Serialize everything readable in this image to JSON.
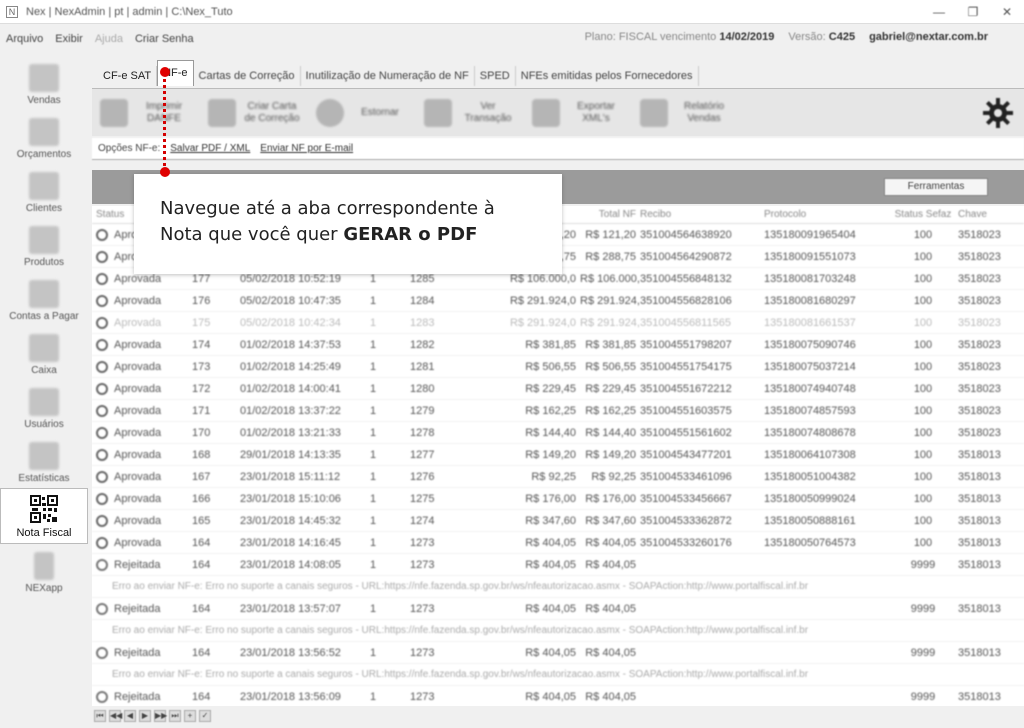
{
  "window": {
    "title": "Nex | NexAdmin | pt | admin | C:\\Nex_Tuto",
    "buttons": [
      "—",
      "❐",
      "✕"
    ]
  },
  "menu": {
    "items": [
      "Arquivo",
      "Exibir",
      "Ajuda",
      "Criar Senha"
    ],
    "plano_label": "Plano:",
    "plano_value": "FISCAL",
    "vencimento_label": "vencimento",
    "vencimento_value": "14/02/2019",
    "versao_label": "Versão:",
    "versao_value": "C425",
    "user_email": "gabriel@nextar.com.br"
  },
  "sidebar": {
    "items": [
      {
        "label": "Vendas",
        "icon": "cart-icon"
      },
      {
        "label": "Orçamentos",
        "icon": "document-icon"
      },
      {
        "label": "Clientes",
        "icon": "clients-icon"
      },
      {
        "label": "Produtos",
        "icon": "products-icon"
      },
      {
        "label": "Contas a Pagar",
        "icon": "bills-icon"
      },
      {
        "label": "Caixa",
        "icon": "cash-register-icon"
      },
      {
        "label": "Usuários",
        "icon": "users-icon"
      },
      {
        "label": "Estatísticas",
        "icon": "chart-icon"
      },
      {
        "label": "Nota Fiscal",
        "icon": "qr-code-icon"
      },
      {
        "label": "NEXapp",
        "icon": "phone-icon"
      }
    ],
    "active": "Nota Fiscal"
  },
  "tabs": [
    {
      "label": "CF-e SAT"
    },
    {
      "label": "NF-e"
    },
    {
      "label": "Cartas de Correção"
    },
    {
      "label": "Inutilização de Numeração de NF"
    },
    {
      "label": "SPED"
    },
    {
      "label": "NFEs emitidas pelos Fornecedores"
    }
  ],
  "toolbar": {
    "buttons": [
      {
        "label": "Imprimir DANFE",
        "icon": "printer-icon"
      },
      {
        "label": "Criar Carta de Correção",
        "icon": "correction-letter-icon"
      },
      {
        "label": "Estornar",
        "icon": "reverse-icon"
      },
      {
        "label": "Ver Transação",
        "icon": "view-transaction-icon"
      },
      {
        "label": "Exportar XML's",
        "icon": "export-icon"
      },
      {
        "label": "Relatório Vendas",
        "icon": "report-icon"
      }
    ]
  },
  "options_bar": {
    "label": "Opções NF-e:",
    "links": [
      "Salvar PDF / XML",
      "Enviar NF por E-mail"
    ]
  },
  "panel": {
    "tools_button": "Ferramentas"
  },
  "table": {
    "columns": [
      "Status",
      "",
      "",
      "",
      "",
      "Total NF",
      "Recibo",
      "Protocolo",
      "Status Sefaz",
      "Chave"
    ],
    "rows": [
      {
        "type": "ok",
        "status": "Aprovada",
        "n": "",
        "date": "",
        "s": "",
        "num": "",
        "total": "R$ 121,20",
        "total2": "R$ 121,20",
        "recibo": "351004564638920",
        "prot": "135180091965404",
        "sefaz": "100",
        "chave": "3518023"
      },
      {
        "type": "ok",
        "status": "Aprovada",
        "n": "",
        "date": "",
        "s": "",
        "num": "",
        "total": "R$ 288,75",
        "total2": "R$ 288,75",
        "recibo": "351004564290872",
        "prot": "135180091551073",
        "sefaz": "100",
        "chave": "3518023"
      },
      {
        "type": "ok",
        "status": "Aprovada",
        "n": "177",
        "date": "05/02/2018 10:52:19",
        "s": "1",
        "num": "1285",
        "total": "R$ 106.000,0",
        "total2": "R$ 106.000,0",
        "recibo": "351004556848132",
        "prot": "135180081703248",
        "sefaz": "100",
        "chave": "3518023"
      },
      {
        "type": "ok",
        "status": "Aprovada",
        "n": "176",
        "date": "05/02/2018 10:47:35",
        "s": "1",
        "num": "1284",
        "total": "R$ 291.924,0",
        "total2": "R$ 291.924,0",
        "recibo": "351004556828106",
        "prot": "135180081680297",
        "sefaz": "100",
        "chave": "3518023"
      },
      {
        "type": "faded",
        "status": "Aprovada",
        "n": "175",
        "date": "05/02/2018 10:42:34",
        "s": "1",
        "num": "1283",
        "total": "R$ 291.924,0",
        "total2": "R$ 291.924,0",
        "recibo": "351004556811565",
        "prot": "135180081661537",
        "sefaz": "100",
        "chave": "3518023"
      },
      {
        "type": "ok",
        "status": "Aprovada",
        "n": "174",
        "date": "01/02/2018 14:37:53",
        "s": "1",
        "num": "1282",
        "total": "R$ 381,85",
        "total2": "R$ 381,85",
        "recibo": "351004551798207",
        "prot": "135180075090746",
        "sefaz": "100",
        "chave": "3518023"
      },
      {
        "type": "ok",
        "status": "Aprovada",
        "n": "173",
        "date": "01/02/2018 14:25:49",
        "s": "1",
        "num": "1281",
        "total": "R$ 506,55",
        "total2": "R$ 506,55",
        "recibo": "351004551754175",
        "prot": "135180075037214",
        "sefaz": "100",
        "chave": "3518023"
      },
      {
        "type": "ok",
        "status": "Aprovada",
        "n": "172",
        "date": "01/02/2018 14:00:41",
        "s": "1",
        "num": "1280",
        "total": "R$ 229,45",
        "total2": "R$ 229,45",
        "recibo": "351004551672212",
        "prot": "135180074940748",
        "sefaz": "100",
        "chave": "3518023"
      },
      {
        "type": "ok",
        "status": "Aprovada",
        "n": "171",
        "date": "01/02/2018 13:37:22",
        "s": "1",
        "num": "1279",
        "total": "R$ 162,25",
        "total2": "R$ 162,25",
        "recibo": "351004551603575",
        "prot": "135180074857593",
        "sefaz": "100",
        "chave": "3518023"
      },
      {
        "type": "ok",
        "status": "Aprovada",
        "n": "170",
        "date": "01/02/2018 13:21:33",
        "s": "1",
        "num": "1278",
        "total": "R$ 144,40",
        "total2": "R$ 144,40",
        "recibo": "351004551561602",
        "prot": "135180074808678",
        "sefaz": "100",
        "chave": "3518023"
      },
      {
        "type": "ok",
        "status": "Aprovada",
        "n": "168",
        "date": "29/01/2018 14:13:35",
        "s": "1",
        "num": "1277",
        "total": "R$ 149,20",
        "total2": "R$ 149,20",
        "recibo": "351004543477201",
        "prot": "135180064107308",
        "sefaz": "100",
        "chave": "3518013"
      },
      {
        "type": "ok",
        "status": "Aprovada",
        "n": "167",
        "date": "23/01/2018 15:11:12",
        "s": "1",
        "num": "1276",
        "total": "R$ 92,25",
        "total2": "R$ 92,25",
        "recibo": "351004533461096",
        "prot": "135180051004382",
        "sefaz": "100",
        "chave": "3518013"
      },
      {
        "type": "ok",
        "status": "Aprovada",
        "n": "166",
        "date": "23/01/2018 15:10:06",
        "s": "1",
        "num": "1275",
        "total": "R$ 176,00",
        "total2": "R$ 176,00",
        "recibo": "351004533456667",
        "prot": "135180050999024",
        "sefaz": "100",
        "chave": "3518013"
      },
      {
        "type": "ok",
        "status": "Aprovada",
        "n": "165",
        "date": "23/01/2018 14:45:32",
        "s": "1",
        "num": "1274",
        "total": "R$ 347,60",
        "total2": "R$ 347,60",
        "recibo": "351004533362872",
        "prot": "135180050888161",
        "sefaz": "100",
        "chave": "3518013"
      },
      {
        "type": "ok",
        "status": "Aprovada",
        "n": "164",
        "date": "23/01/2018 14:16:45",
        "s": "1",
        "num": "1273",
        "total": "R$ 404,05",
        "total2": "R$ 404,05",
        "recibo": "351004533260176",
        "prot": "135180050764573",
        "sefaz": "100",
        "chave": "3518013"
      },
      {
        "type": "rej",
        "status": "Rejeitada",
        "n": "164",
        "date": "23/01/2018 14:08:05",
        "s": "1",
        "num": "1273",
        "total": "R$ 404,05",
        "total2": "R$ 404,05",
        "recibo": "",
        "prot": "",
        "sefaz": "9999",
        "chave": "3518013"
      },
      {
        "type": "err",
        "text": "Erro ao enviar NF-e: Erro no suporte a canais seguros - URL:https://nfe.fazenda.sp.gov.br/ws/nfeautorizacao.asmx - SOAPAction:http://www.portalfiscal.inf.br"
      },
      {
        "type": "rej",
        "status": "Rejeitada",
        "n": "164",
        "date": "23/01/2018 13:57:07",
        "s": "1",
        "num": "1273",
        "total": "R$ 404,05",
        "total2": "R$ 404,05",
        "recibo": "",
        "prot": "",
        "sefaz": "9999",
        "chave": "3518013"
      },
      {
        "type": "err",
        "text": "Erro ao enviar NF-e: Erro no suporte a canais seguros - URL:https://nfe.fazenda.sp.gov.br/ws/nfeautorizacao.asmx - SOAPAction:http://www.portalfiscal.inf.br"
      },
      {
        "type": "rej",
        "status": "Rejeitada",
        "n": "164",
        "date": "23/01/2018 13:56:52",
        "s": "1",
        "num": "1273",
        "total": "R$ 404,05",
        "total2": "R$ 404,05",
        "recibo": "",
        "prot": "",
        "sefaz": "9999",
        "chave": "3518013"
      },
      {
        "type": "err",
        "text": "Erro ao enviar NF-e: Erro no suporte a canais seguros - URL:https://nfe.fazenda.sp.gov.br/ws/nfeautorizacao.asmx - SOAPAction:http://www.portalfiscal.inf.br"
      },
      {
        "type": "rej",
        "status": "Rejeitada",
        "n": "164",
        "date": "23/01/2018 13:56:09",
        "s": "1",
        "num": "1273",
        "total": "R$ 404,05",
        "total2": "R$ 404,05",
        "recibo": "",
        "prot": "",
        "sefaz": "9999",
        "chave": "3518013"
      }
    ]
  },
  "pager": [
    "⏮",
    "◀◀",
    "◀",
    "▶",
    "▶▶",
    "⏭",
    "+",
    "✓"
  ],
  "callout": {
    "text_before": "Navegue até a aba correspondente à Nota que você quer ",
    "text_bold": "GERAR o PDF"
  }
}
